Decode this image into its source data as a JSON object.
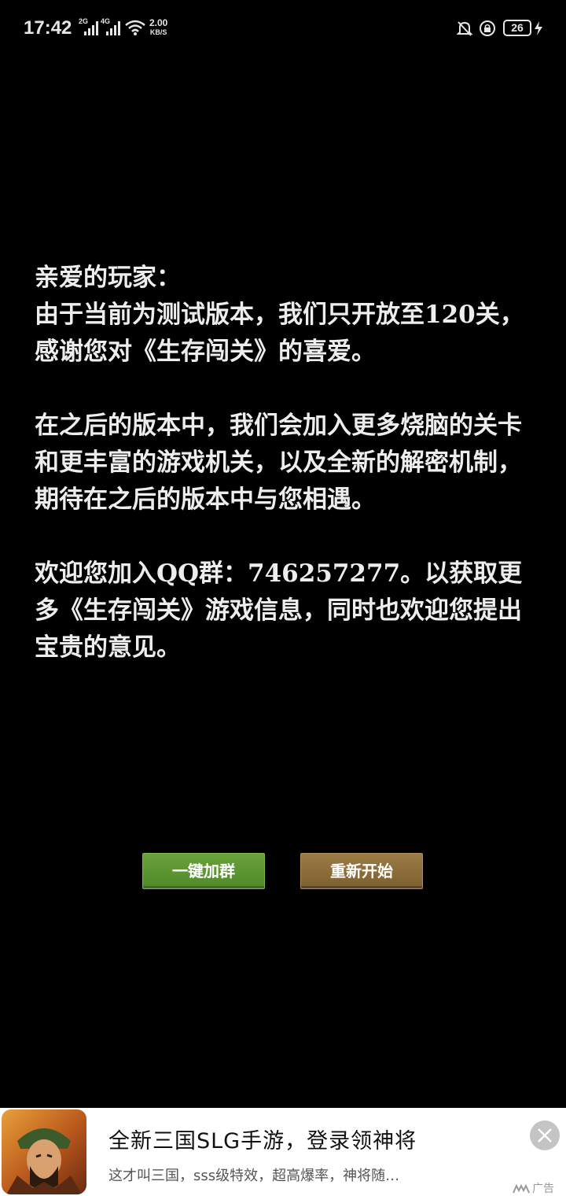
{
  "status_bar": {
    "time": "17:42",
    "sim1_label": "2G",
    "sim2_label": "4G",
    "net_speed_value": "2.00",
    "net_speed_unit": "KB/S",
    "battery_level": "26",
    "icons": [
      "signal-icon",
      "signal-icon",
      "wifi-icon",
      "bell-muted-icon",
      "rotation-lock-icon",
      "battery-icon",
      "charging-icon"
    ]
  },
  "message": {
    "greeting": "亲爱的玩家：",
    "paragraph1": "由于当前为测试版本，我们只开放至120关，感谢您对《生存闯关》的喜爱。",
    "paragraph2": "在之后的版本中，我们会加入更多烧脑的关卡和更丰富的游戏机关，以及全新的解密机制，期待在之后的版本中与您相遇。",
    "paragraph3": "欢迎您加入QQ群：746257277。以获取更多《生存闯关》游戏信息，同时也欢迎您提出宝贵的意见。"
  },
  "buttons": {
    "join_group": "一键加群",
    "restart": "重新开始",
    "colors": {
      "green": "#5a9630",
      "brown": "#8a6b38"
    }
  },
  "ad": {
    "title": "全新三国SLG手游，登录领神将",
    "description": "这才叫三国，sss级特效，超高爆率，神将随…",
    "marker": "广告"
  }
}
